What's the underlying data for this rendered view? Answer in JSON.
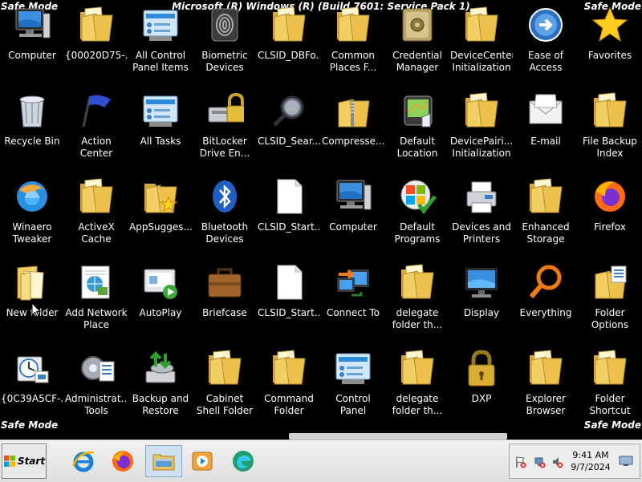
{
  "header": {
    "title": "Microsoft (R) Windows (R) (Build 7601: Service Pack 1)",
    "safe_mode": "Safe Mode"
  },
  "desktop_icons": [
    {
      "label": "Computer",
      "icon": "computer-icon"
    },
    {
      "label": "{00020D75-...",
      "icon": "folder-icon"
    },
    {
      "label": "All Control Panel Items",
      "icon": "control-panel-icon"
    },
    {
      "label": "Biometric Devices",
      "icon": "fingerprint-icon"
    },
    {
      "label": "CLSID_DBFo...",
      "icon": "folder-icon"
    },
    {
      "label": "Common Places F...",
      "icon": "folder-icon"
    },
    {
      "label": "Credential Manager",
      "icon": "vault-icon"
    },
    {
      "label": "DeviceCenter Initialization",
      "icon": "folder-icon"
    },
    {
      "label": "Ease of Access Center",
      "icon": "ease-of-access-icon"
    },
    {
      "label": "Favorites",
      "icon": "star-icon"
    },
    {
      "label": "Recycle Bin",
      "icon": "recycle-bin-icon"
    },
    {
      "label": "Action Center",
      "icon": "flag-icon"
    },
    {
      "label": "All Tasks",
      "icon": "control-panel-icon"
    },
    {
      "label": "BitLocker Drive En...",
      "icon": "bitlocker-icon"
    },
    {
      "label": "CLSID_Sear...",
      "icon": "magnifier-icon"
    },
    {
      "label": "Compresse...",
      "icon": "zip-folder-icon"
    },
    {
      "label": "Default Location",
      "icon": "gps-icon"
    },
    {
      "label": "DevicePairi... Initialization",
      "icon": "folder-icon"
    },
    {
      "label": "E-mail",
      "icon": "envelope-icon"
    },
    {
      "label": "File Backup Index",
      "icon": "folder-icon"
    },
    {
      "label": "Winaero Tweaker",
      "icon": "winaero-icon"
    },
    {
      "label": "ActiveX Cache Folder",
      "icon": "folder-icon"
    },
    {
      "label": "AppSugges...",
      "icon": "folder-star-icon"
    },
    {
      "label": "Bluetooth Devices",
      "icon": "bluetooth-icon"
    },
    {
      "label": "CLSID_Start...",
      "icon": "blank-document-icon"
    },
    {
      "label": "Computer",
      "icon": "computer-icon"
    },
    {
      "label": "Default Programs",
      "icon": "windows-check-icon"
    },
    {
      "label": "Devices and Printers",
      "icon": "printer-icon"
    },
    {
      "label": "Enhanced Storage Da...",
      "icon": "folder-icon"
    },
    {
      "label": "Firefox",
      "icon": "firefox-icon"
    },
    {
      "label": "New folder",
      "icon": "open-folder-icon"
    },
    {
      "label": "Add Network Place",
      "icon": "network-place-icon"
    },
    {
      "label": "AutoPlay",
      "icon": "autoplay-icon"
    },
    {
      "label": "Briefcase",
      "icon": "briefcase-icon"
    },
    {
      "label": "CLSID_Start...",
      "icon": "blank-document-icon"
    },
    {
      "label": "Connect To",
      "icon": "connect-icon"
    },
    {
      "label": "delegate folder th...",
      "icon": "folder-icon"
    },
    {
      "label": "Display",
      "icon": "monitor-icon"
    },
    {
      "label": "Everything",
      "icon": "everything-icon"
    },
    {
      "label": "Folder Options",
      "icon": "folder-options-icon"
    },
    {
      "label": "{0C39A5CF-...",
      "icon": "scheduler-icon"
    },
    {
      "label": "Administrat... Tools",
      "icon": "admin-tools-icon"
    },
    {
      "label": "Backup and Restore",
      "icon": "backup-icon"
    },
    {
      "label": "Cabinet Shell Folder",
      "icon": "folder-icon"
    },
    {
      "label": "Command Folder",
      "icon": "folder-icon"
    },
    {
      "label": "Control Panel",
      "icon": "control-panel-icon"
    },
    {
      "label": "delegate folder th...",
      "icon": "folder-icon"
    },
    {
      "label": "DXP",
      "icon": "padlock-icon"
    },
    {
      "label": "Explorer Browser Res...",
      "icon": "folder-icon"
    },
    {
      "label": "Folder Shortcut",
      "icon": "folder-icon"
    }
  ],
  "taskbar": {
    "start_label": "Start",
    "pinned": [
      {
        "name": "internet-explorer",
        "icon": "ie-icon"
      },
      {
        "name": "firefox",
        "icon": "firefox-icon"
      },
      {
        "name": "explorer",
        "icon": "explorer-icon",
        "active": true
      },
      {
        "name": "media-player",
        "icon": "media-player-icon"
      },
      {
        "name": "edge",
        "icon": "edge-icon"
      }
    ],
    "clock": {
      "time": "9:41 AM",
      "date": "9/7/2024"
    }
  }
}
